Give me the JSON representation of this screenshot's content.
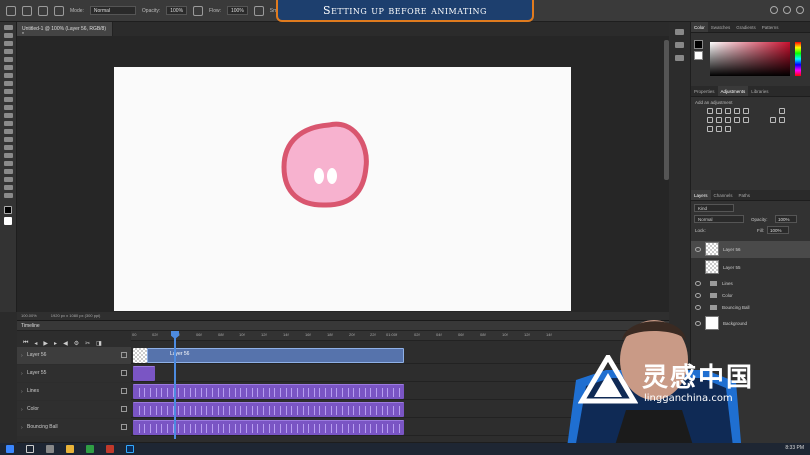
{
  "banner": {
    "title": "Setting up before animating"
  },
  "options_bar": {
    "mode_label": "Mode:",
    "mode_value": "Normal",
    "opacity_label": "Opacity:",
    "opacity_value": "100%",
    "flow_label": "Flow:",
    "flow_value": "100%",
    "smoothing_label": "Sm"
  },
  "document": {
    "tab_title": "Untitled-1 @ 100% (Layer 56, RGB/8) *",
    "zoom": "100.00%",
    "doc_info": "1920 px x 1080 px (300 ppi)"
  },
  "timeline": {
    "panel_title": "Timeline",
    "ruler_labels": [
      "00",
      "02f",
      "04f",
      "06f",
      "08f",
      "10f",
      "12f",
      "14f",
      "16f",
      "18f",
      "20f",
      "22f",
      "01:00f",
      "02f",
      "04f",
      "06f",
      "08f",
      "10f",
      "12f",
      "14f"
    ],
    "tracks": [
      {
        "name": "Layer 56",
        "clip_label": "Layer 56",
        "selected": true
      },
      {
        "name": "Layer 55",
        "selected": false
      },
      {
        "name": "Lines",
        "selected": false
      },
      {
        "name": "Color",
        "selected": false
      },
      {
        "name": "Bouncing Ball",
        "selected": false
      }
    ],
    "footer": {
      "frame_left": "000",
      "timecode": "0:00:00:04",
      "fps": "(24.00 fps)"
    }
  },
  "right_panel": {
    "color_tabs": [
      "Color",
      "Swatches",
      "Gradients",
      "Patterns"
    ],
    "adj_tabs": [
      "Properties",
      "Adjustments",
      "Libraries"
    ],
    "adj_hint": "Add an adjustment",
    "layer_tabs": [
      "Layers",
      "Channels",
      "Paths"
    ],
    "kind_label": "Kind",
    "blend_mode": "Normal",
    "opacity_label": "Opacity:",
    "opacity_value": "100%",
    "lock_label": "Lock:",
    "fill_label": "Fill:",
    "fill_value": "100%",
    "layers": [
      {
        "name": "Layer 56",
        "type": "pixel",
        "selected": true
      },
      {
        "name": "Layer 55",
        "type": "pixel",
        "selected": false
      },
      {
        "name": "Lines",
        "type": "group",
        "selected": false
      },
      {
        "name": "Color",
        "type": "group",
        "selected": false
      },
      {
        "name": "Bouncing Ball",
        "type": "group",
        "selected": false
      },
      {
        "name": "Background",
        "type": "background",
        "selected": false
      }
    ]
  },
  "watermark": {
    "text_cn": "灵感中国",
    "url": "lingganchina.com"
  },
  "taskbar": {
    "clock": "8:33 PM"
  },
  "colors": {
    "accent_orange": "#e07b1e",
    "banner_blue": "#1d3f6e",
    "clip_blue": "#5673ac",
    "clip_purple": "#7a55c4",
    "blob_pink": "#f7b2cf",
    "blob_outline": "#d9566f"
  }
}
